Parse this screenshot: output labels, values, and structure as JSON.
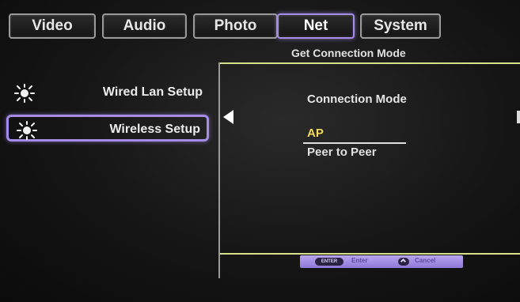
{
  "tabs": [
    {
      "label": "Video",
      "active": false
    },
    {
      "label": "Audio",
      "active": false
    },
    {
      "label": "Photo",
      "active": false
    },
    {
      "label": "Net",
      "active": true
    },
    {
      "label": "System",
      "active": false
    }
  ],
  "header": {
    "title": "Get Connection Mode"
  },
  "sidebar": {
    "items": [
      {
        "label": "Wired Lan Setup",
        "icon": "sun-icon",
        "selected": false
      },
      {
        "label": "Wireless Setup",
        "icon": "sun-icon",
        "selected": true
      }
    ]
  },
  "main": {
    "section_title": "Connection Mode",
    "options": [
      {
        "label": "AP",
        "highlighted": true
      },
      {
        "label": "Peer to Peer",
        "highlighted": false
      }
    ]
  },
  "help": {
    "enter_key": "ENTER",
    "enter_label": "Enter",
    "cancel_label": "Cancel"
  },
  "colors": {
    "accent_border": "#a48ce8",
    "highlight_text": "#f3d95a",
    "separator_line": "#d8e08a"
  }
}
